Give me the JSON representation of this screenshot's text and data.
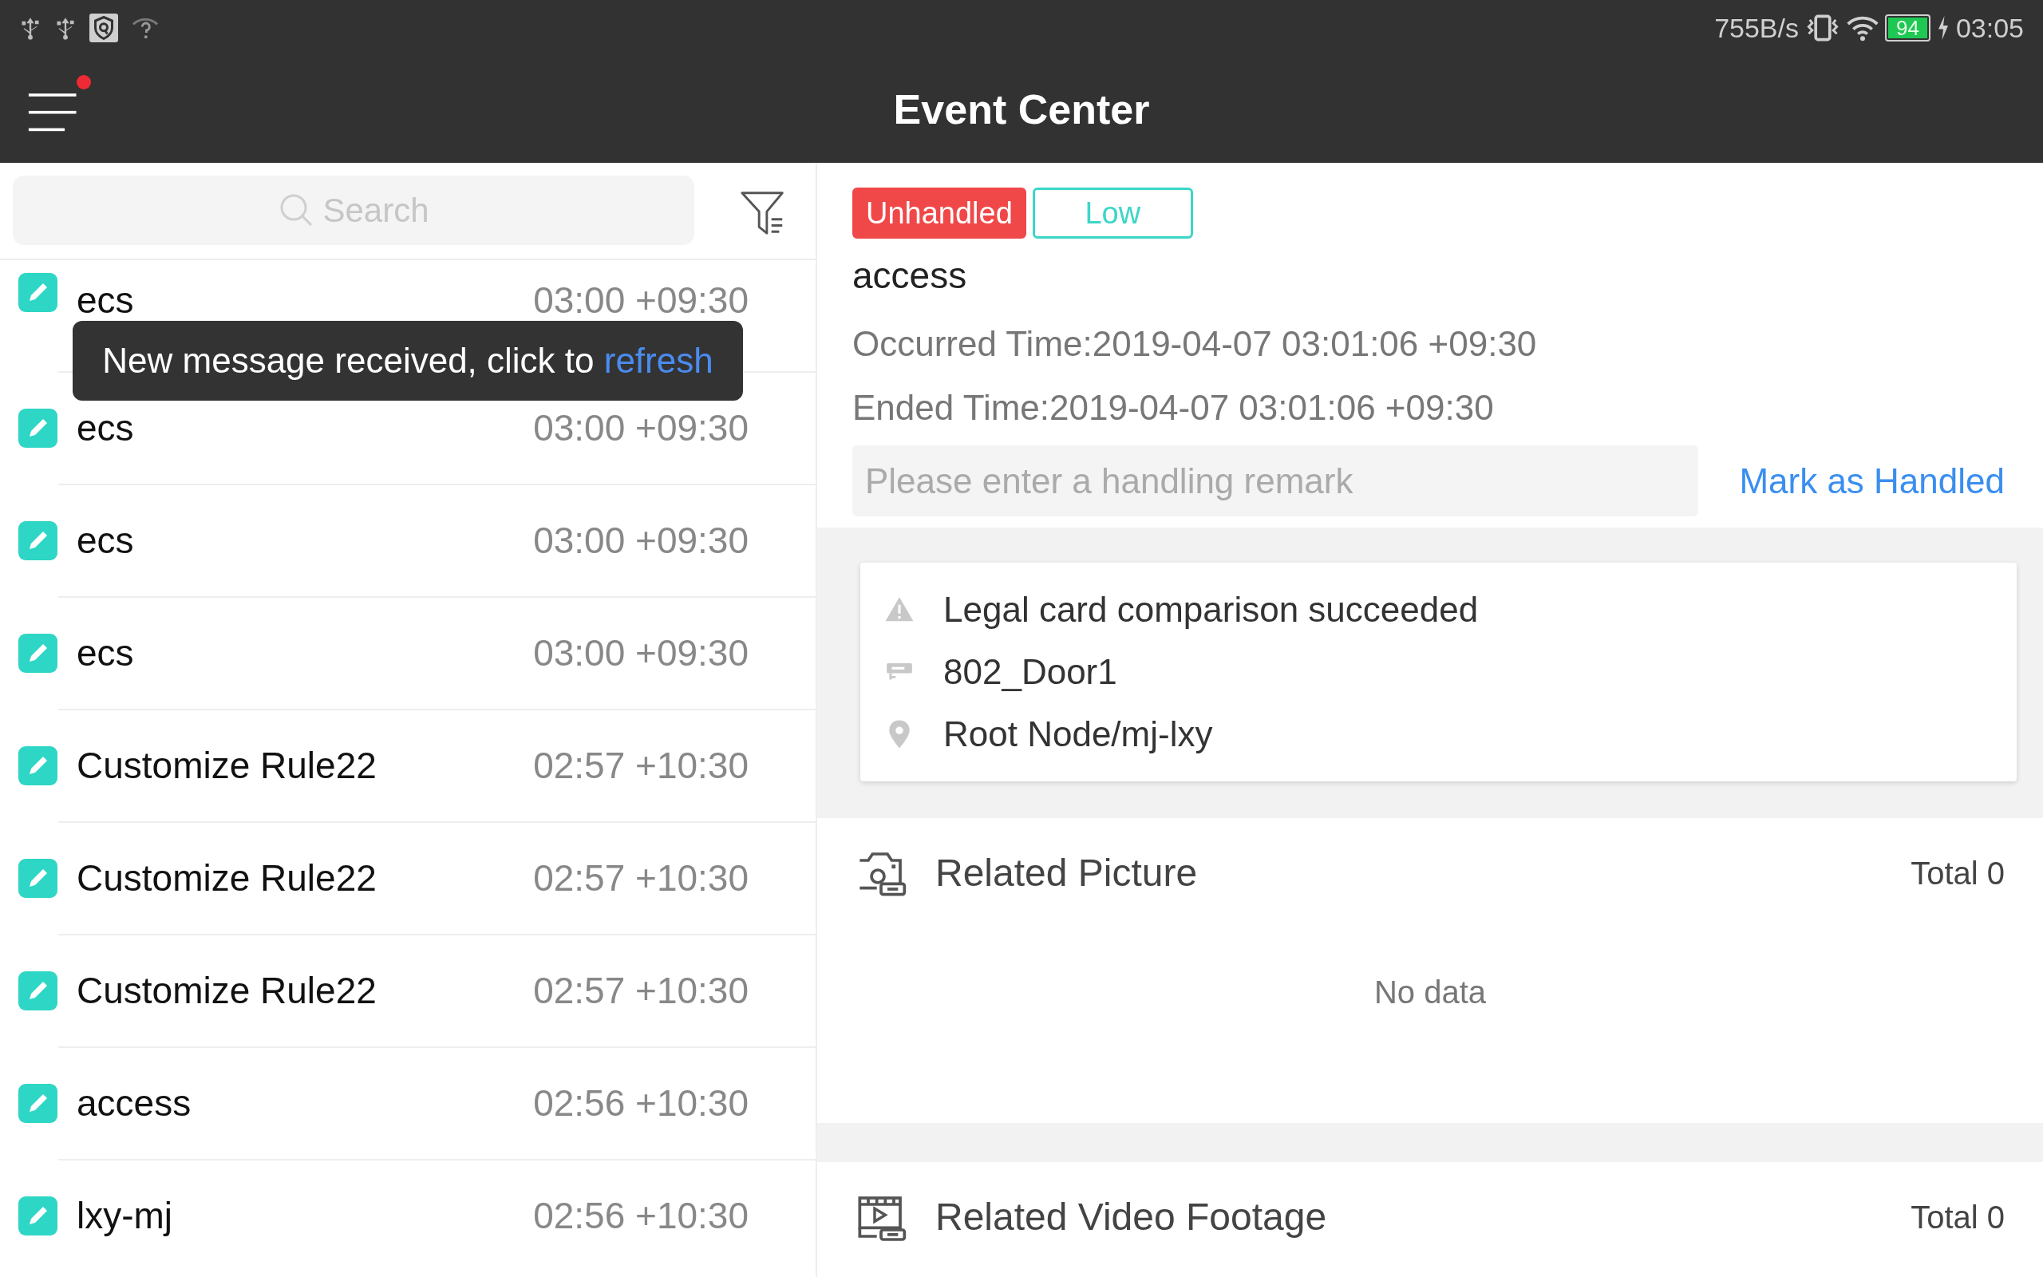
{
  "status_bar": {
    "net_speed": "755B/s",
    "battery": "94",
    "time": "03:05"
  },
  "header": {
    "title": "Event Center",
    "menu_badge": true
  },
  "search": {
    "placeholder": "Search"
  },
  "events": [
    {
      "name": "ecs",
      "time": "03:00 +09:30"
    },
    {
      "name": "ecs",
      "time": "03:00 +09:30"
    },
    {
      "name": "ecs",
      "time": "03:00 +09:30"
    },
    {
      "name": "ecs",
      "time": "03:00 +09:30"
    },
    {
      "name": "Customize Rule22",
      "time": "02:57 +10:30"
    },
    {
      "name": "Customize Rule22",
      "time": "02:57 +10:30"
    },
    {
      "name": "Customize Rule22",
      "time": "02:57 +10:30"
    },
    {
      "name": "access",
      "time": "02:56 +10:30"
    },
    {
      "name": "lxy-mj",
      "time": "02:56 +10:30"
    }
  ],
  "toast": {
    "text": "New message received, click to ",
    "link": "refresh"
  },
  "detail": {
    "tags": [
      {
        "label": "Unhandled",
        "kind": "status"
      },
      {
        "label": "Low",
        "kind": "level"
      }
    ],
    "name": "access",
    "occurred": "Occurred Time:2019-04-07 03:01:06 +09:30",
    "ended": "Ended Time:2019-04-07 03:01:06 +09:30",
    "remark": {
      "placeholder": "Please enter a handling remark"
    },
    "action": "Mark as Handled",
    "info": [
      {
        "kind": "alarm",
        "text": "Legal card comparison succeeded"
      },
      {
        "kind": "camera",
        "text": "802_Door1"
      },
      {
        "kind": "location",
        "text": "Root Node/mj-lxy"
      }
    ]
  },
  "sections": [
    {
      "kind": "picture",
      "title": "Related Picture",
      "total": "Total 0",
      "empty": "No data"
    },
    {
      "kind": "video",
      "title": "Related Video Footage",
      "total": "Total 0"
    }
  ]
}
